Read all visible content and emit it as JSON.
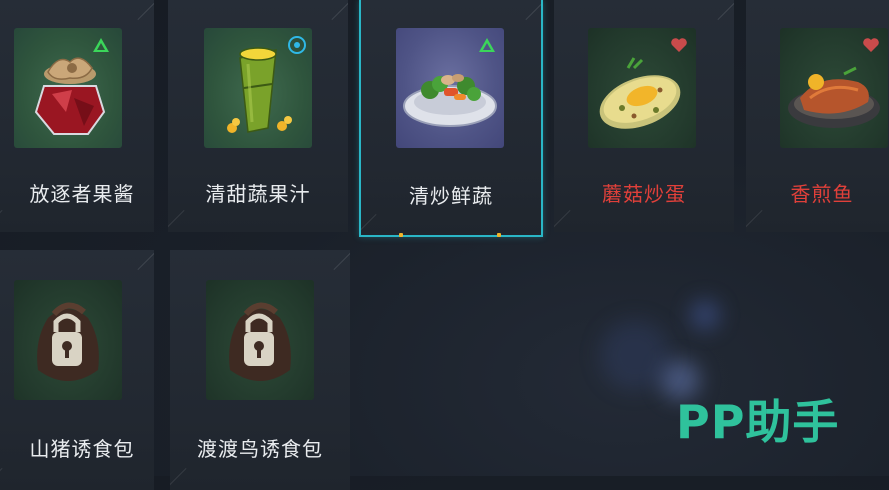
{
  "items_row1": [
    {
      "name": "放逐者果酱",
      "badge": "triangle-badge-icon",
      "label_color": "white"
    },
    {
      "name": "清甜蔬果汁",
      "badge": "circle-badge-icon",
      "label_color": "white"
    },
    {
      "name": "清炒鲜蔬",
      "badge": "triangle-badge-icon",
      "label_color": "white",
      "selected": true
    },
    {
      "name": "蘑菇炒蛋",
      "badge": "heart-badge-icon",
      "label_color": "red"
    },
    {
      "name": "香煎鱼",
      "badge": "heart-badge-icon",
      "label_color": "red"
    }
  ],
  "items_row2": [
    {
      "name": "山猪诱食包",
      "icon": "locked-bag-icon"
    },
    {
      "name": "渡渡鸟诱食包",
      "icon": "locked-bag-icon"
    }
  ],
  "colors": {
    "selected_border": "#2ab6c6",
    "red_label": "#e0403a",
    "badge_green": "#3bd65a",
    "badge_cyan": "#2fb8e6",
    "badge_heart": "#c94b4b",
    "watermark": "#2fc29c"
  },
  "watermark": {
    "text": "PP助手"
  }
}
